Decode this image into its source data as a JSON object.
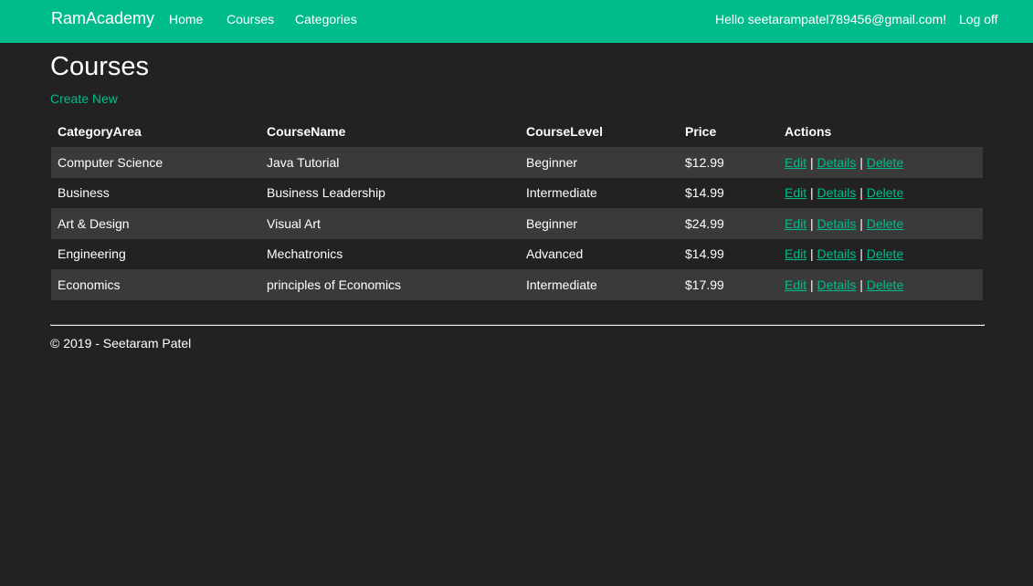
{
  "navbar": {
    "brand": "RamAcademy",
    "links": [
      "Home",
      "Courses",
      "Categories"
    ],
    "greeting": "Hello seetarampatel789456@gmail.com!",
    "logoff": "Log off",
    "color": "#00bc8c"
  },
  "page": {
    "title": "Courses",
    "create_new": "Create New"
  },
  "table": {
    "headers": [
      "CategoryArea",
      "CourseName",
      "CourseLevel",
      "Price",
      "Actions"
    ],
    "rows": [
      {
        "category": "Computer Science",
        "name": "Java Tutorial",
        "level": "Beginner",
        "price": "$12.99"
      },
      {
        "category": "Business",
        "name": "Business Leadership",
        "level": "Intermediate",
        "price": "$14.99"
      },
      {
        "category": "Art & Design",
        "name": "Visual Art",
        "level": "Beginner",
        "price": "$24.99"
      },
      {
        "category": "Engineering",
        "name": "Mechatronics",
        "level": "Advanced",
        "price": "$14.99"
      },
      {
        "category": "Economics",
        "name": "principles of Economics",
        "level": "Intermediate",
        "price": "$17.99"
      }
    ],
    "actions": {
      "edit": "Edit",
      "details": "Details",
      "delete": "Delete",
      "separator": "|"
    }
  },
  "footer": {
    "text": "© 2019 - Seetaram Patel"
  },
  "colors": {
    "background": "#222222",
    "accent": "#00bc8c",
    "row_alt": "#3a3a3a"
  }
}
